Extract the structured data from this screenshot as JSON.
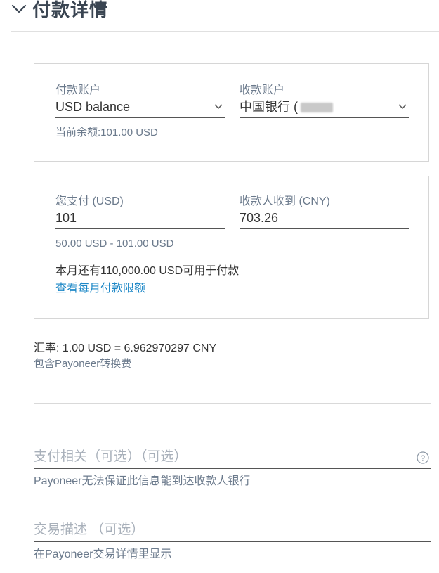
{
  "header": {
    "title": "付款详情",
    "toggle_icon": "chevron-down-icon"
  },
  "accounts": {
    "from_label": "付款账户",
    "from_value": "USD balance",
    "from_balance": "当前余额:101.00 USD",
    "to_label": "收款账户",
    "to_value": "中国银行 ("
  },
  "amounts": {
    "pay_label": "您支付 (USD)",
    "pay_value": "101",
    "receive_label": "收款人收到 (CNY)",
    "receive_value": "703.26",
    "range": "50.00 USD - 101.00 USD",
    "monthly_limit_note": "本月还有110,000.00 USD可用于付款",
    "monthly_limit_link": "查看每月付款限额"
  },
  "exchange": {
    "rate": "汇率: 1.00 USD = 6.962970297 CNY",
    "fee_note": "包含Payoneer转换费"
  },
  "payment_reference": {
    "placeholder": "支付相关（可选）（可选）",
    "hint": "Payoneer无法保证此信息能到达收款人银行"
  },
  "transaction_description": {
    "placeholder": "交易描述 （可选）",
    "hint": "在Payoneer交易详情里显示"
  },
  "colors": {
    "link": "#1e88c7",
    "muted_text": "#6b7a8c",
    "placeholder": "#a8b0ba",
    "border": "#d6d6d6"
  }
}
